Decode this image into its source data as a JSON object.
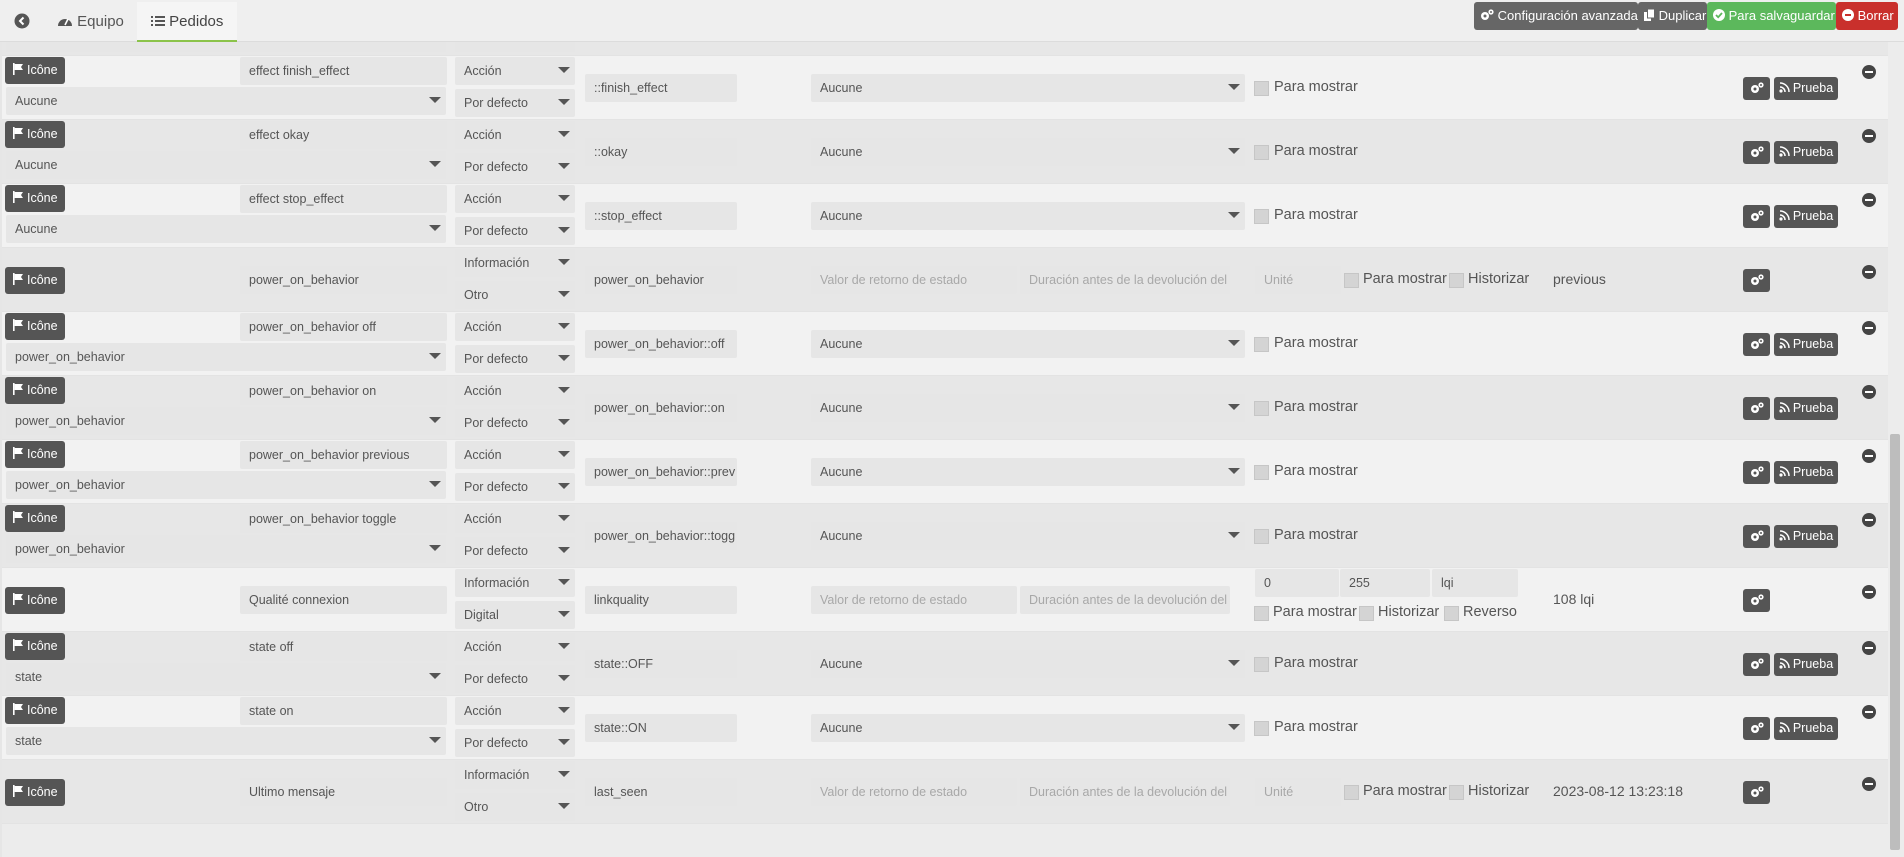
{
  "nav": {
    "back_icon": "arrow-left-icon",
    "equipo_label": "Equipo",
    "pedidos_label": "Pedidos"
  },
  "toolbar": {
    "advanced_label": "Configuración avanzada",
    "duplicate_label": "Duplicar",
    "save_label": "Para salvaguardar",
    "delete_label": "Borrar"
  },
  "colors": {
    "save": "#5cb85c",
    "delete": "#c9302c",
    "button_dark": "#555555",
    "active_tab_accent": "#8bc34a"
  },
  "commands": {
    "partial_top": {
      "select_value": "Aucune",
      "subtype": "Por defecto"
    },
    "rows": [
      {
        "kind": "action",
        "icon_label": "Icône",
        "name": "effect finish_effect",
        "info_value": "Aucune",
        "type": "Acción",
        "subtype": "Por defecto",
        "logical_id": "::finish_effect",
        "value_select": "Aucune",
        "show_label": "Para mostrar",
        "gear_icon": "cogs-icon",
        "test_label": "Prueba"
      },
      {
        "kind": "action",
        "icon_label": "Icône",
        "name": "effect okay",
        "info_value": "Aucune",
        "type": "Acción",
        "subtype": "Por defecto",
        "logical_id": "::okay",
        "value_select": "Aucune",
        "show_label": "Para mostrar",
        "gear_icon": "cogs-icon",
        "test_label": "Prueba"
      },
      {
        "kind": "action",
        "icon_label": "Icône",
        "name": "effect stop_effect",
        "info_value": "Aucune",
        "type": "Acción",
        "subtype": "Por defecto",
        "logical_id": "::stop_effect",
        "value_select": "Aucune",
        "show_label": "Para mostrar",
        "gear_icon": "cogs-icon",
        "test_label": "Prueba"
      },
      {
        "kind": "info",
        "icon_label": "Icône",
        "name": "power_on_behavior",
        "type": "Información",
        "subtype": "Otro",
        "logical_id": "power_on_behavior",
        "return_placeholder": "Valor de retorno de estado",
        "duration_placeholder": "Duración antes de la devolución del",
        "unit_placeholder": "Unité",
        "show_label": "Para mostrar",
        "history_label": "Historizar",
        "current_value": "previous",
        "gear_icon": "cogs-icon"
      },
      {
        "kind": "action",
        "icon_label": "Icône",
        "name": "power_on_behavior off",
        "info_value": "power_on_behavior",
        "type": "Acción",
        "subtype": "Por defecto",
        "logical_id": "power_on_behavior::off",
        "value_select": "Aucune",
        "show_label": "Para mostrar",
        "gear_icon": "cogs-icon",
        "test_label": "Prueba"
      },
      {
        "kind": "action",
        "icon_label": "Icône",
        "name": "power_on_behavior on",
        "info_value": "power_on_behavior",
        "type": "Acción",
        "subtype": "Por defecto",
        "logical_id": "power_on_behavior::on",
        "value_select": "Aucune",
        "show_label": "Para mostrar",
        "gear_icon": "cogs-icon",
        "test_label": "Prueba"
      },
      {
        "kind": "action",
        "icon_label": "Icône",
        "name": "power_on_behavior previous",
        "info_value": "power_on_behavior",
        "type": "Acción",
        "subtype": "Por defecto",
        "logical_id": "power_on_behavior::prev",
        "value_select": "Aucune",
        "show_label": "Para mostrar",
        "gear_icon": "cogs-icon",
        "test_label": "Prueba"
      },
      {
        "kind": "action",
        "icon_label": "Icône",
        "name": "power_on_behavior toggle",
        "info_value": "power_on_behavior",
        "type": "Acción",
        "subtype": "Por defecto",
        "logical_id": "power_on_behavior::togg",
        "value_select": "Aucune",
        "show_label": "Para mostrar",
        "gear_icon": "cogs-icon",
        "test_label": "Prueba"
      },
      {
        "kind": "info_numeric",
        "icon_label": "Icône",
        "name": "Qualité connexion",
        "type": "Información",
        "subtype": "Digital",
        "logical_id": "linkquality",
        "return_placeholder": "Valor de retorno de estado",
        "duration_placeholder": "Duración antes de la devolución del",
        "min_value": "0",
        "max_value": "255",
        "unit_value": "lqi",
        "show_label": "Para mostrar",
        "history_label": "Historizar",
        "invert_label": "Reverso",
        "current_value": "108 lqi",
        "gear_icon": "cogs-icon"
      },
      {
        "kind": "action",
        "icon_label": "Icône",
        "name": "state off",
        "info_value": "state",
        "type": "Acción",
        "subtype": "Por defecto",
        "logical_id": "state::OFF",
        "value_select": "Aucune",
        "show_label": "Para mostrar",
        "gear_icon": "cogs-icon",
        "test_label": "Prueba"
      },
      {
        "kind": "action",
        "icon_label": "Icône",
        "name": "state on",
        "info_value": "state",
        "type": "Acción",
        "subtype": "Por defecto",
        "logical_id": "state::ON",
        "value_select": "Aucune",
        "show_label": "Para mostrar",
        "gear_icon": "cogs-icon",
        "test_label": "Prueba"
      },
      {
        "kind": "info",
        "icon_label": "Icône",
        "name": "Ultimo mensaje",
        "type": "Información",
        "subtype": "Otro",
        "logical_id": "last_seen",
        "return_placeholder": "Valor de retorno de estado",
        "duration_placeholder": "Duración antes de la devolución del",
        "unit_placeholder": "Unité",
        "show_label": "Para mostrar",
        "history_label": "Historizar",
        "current_value": "2023-08-12 13:23:18",
        "gear_icon": "cogs-icon"
      }
    ]
  }
}
